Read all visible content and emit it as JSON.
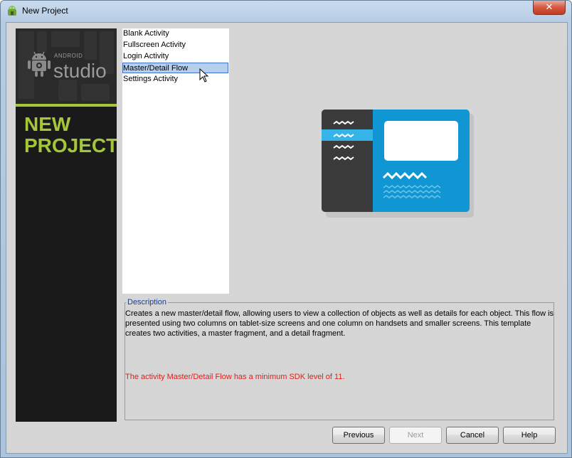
{
  "window": {
    "title": "New Project",
    "close_glyph": "✕"
  },
  "branding": {
    "android_word": "ANDROID",
    "studio_word": "studio",
    "heading_line1": "NEW",
    "heading_line2": "PROJECT",
    "accent_color": "#a4c639"
  },
  "templates": {
    "items": [
      {
        "label": "Blank Activity"
      },
      {
        "label": "Fullscreen Activity"
      },
      {
        "label": "Login Activity"
      },
      {
        "label": "Master/Detail Flow",
        "selected": true
      },
      {
        "label": "Settings Activity"
      }
    ]
  },
  "description": {
    "legend": "Description",
    "text": "Creates a new master/detail flow, allowing users to view a collection of objects as well as details for each object. This flow is presented using two columns on tablet-size screens and one column on handsets and smaller screens. This template creates two activities, a master fragment, and a detail fragment.",
    "sdk_warning": "The activity Master/Detail Flow has a minimum SDK level of 11.",
    "warning_color": "#e0201b"
  },
  "buttons": {
    "previous": "Previous",
    "next": "Next",
    "cancel": "Cancel",
    "help": "Help"
  },
  "icons": {
    "app": "android-studio-icon",
    "pointer": "mouse-cursor-icon"
  }
}
